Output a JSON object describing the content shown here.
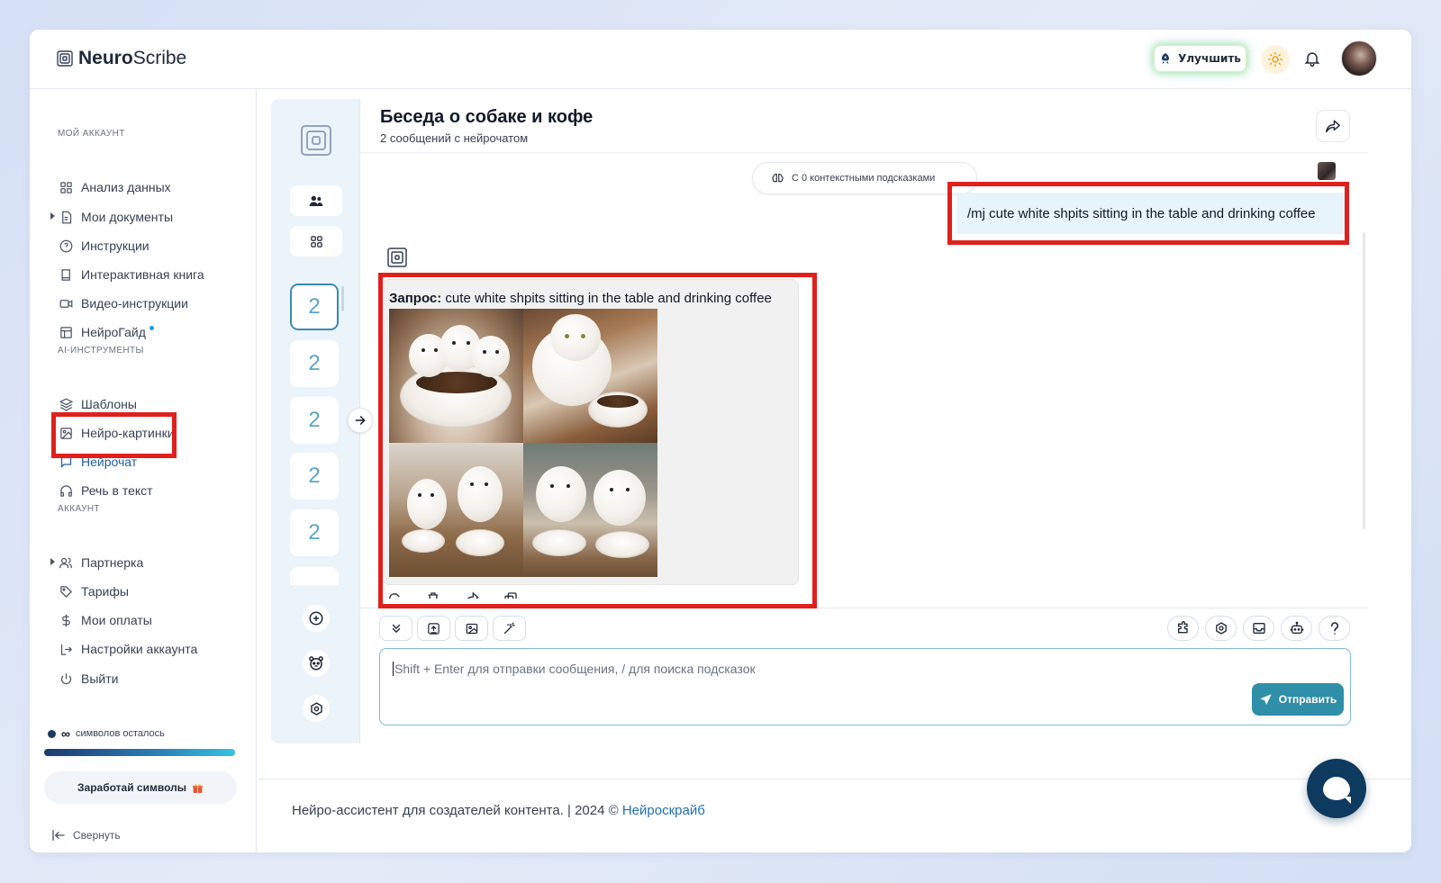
{
  "app": {
    "logo_bold": "Neuro",
    "logo_regular": "Scribe"
  },
  "header": {
    "upgrade_label": "Улучшить"
  },
  "sidebar": {
    "section_my_account": "МОЙ АККАУНТ",
    "section_ai_tools": "AI-ИНСТРУМЕНТЫ",
    "section_account": "АККАУНТ",
    "my_account_items": [
      {
        "label": "Анализ данных",
        "icon": "grid-icon"
      },
      {
        "label": "Мои документы",
        "icon": "document-icon",
        "expandable": true
      },
      {
        "label": "Инструкции",
        "icon": "help-circle-icon"
      },
      {
        "label": "Интерактивная книга",
        "icon": "book-icon"
      },
      {
        "label": "Видео-инструкции",
        "icon": "video-icon"
      },
      {
        "label": "НейроГайд",
        "icon": "layout-icon",
        "badge": true
      }
    ],
    "ai_tools_items": [
      {
        "label": "Шаблоны",
        "icon": "layers-icon"
      },
      {
        "label": "Нейро-картинки",
        "icon": "image-icon"
      },
      {
        "label": "Нейрочат",
        "icon": "chat-icon",
        "active": true
      },
      {
        "label": "Речь в текст",
        "icon": "headphones-icon"
      }
    ],
    "account_items": [
      {
        "label": "Партнерка",
        "icon": "users-icon",
        "expandable": true
      },
      {
        "label": "Тарифы",
        "icon": "tag-icon"
      },
      {
        "label": "Мои оплаты",
        "icon": "dollar-icon"
      },
      {
        "label": "Настройки аккаунта",
        "icon": "login-icon"
      },
      {
        "label": "Выйти",
        "icon": "power-icon"
      }
    ],
    "symbols_infinity": "∞",
    "symbols_label": "символов осталось",
    "symbols_progress": 1.0,
    "earn_label": "Заработай символы",
    "collapse_label": "Свернуть"
  },
  "rail": {
    "chats": [
      "2",
      "2",
      "2",
      "2",
      "2"
    ]
  },
  "chat": {
    "title": "Беседа о собаке и кофе",
    "subtitle": "2 сообщений с нейрочатом",
    "context_pill": "С 0 контекстными подсказками",
    "user_message": "/mj cute white shpits sitting in the table and drinking coffee",
    "bot_query_label": "Запрос:",
    "bot_query_text": " cute white shpits sitting in the table and drinking coffee",
    "input_placeholder": "Shift + Enter для отправки сообщения, / для поиска подсказок",
    "send_label": "Отправить"
  },
  "footer": {
    "text": "Нейро-ассистент для создателей контента.  | 2024 © ",
    "link": "Нейроскрайб"
  },
  "colors": {
    "accent": "#2f8ea8",
    "highlight": "#e0201c",
    "fab": "#0f3a5f"
  }
}
